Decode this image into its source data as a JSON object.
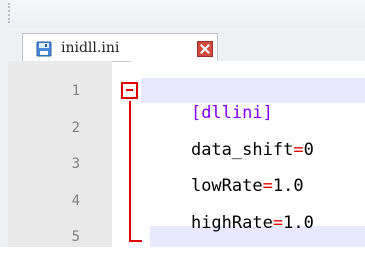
{
  "tab": {
    "label": "inidll.ini",
    "close_icon": "close-icon",
    "save_icon": "save-icon"
  },
  "editor": {
    "line_numbers": [
      "1",
      "2",
      "3",
      "4",
      "5"
    ],
    "lines": {
      "section": "[dllini]",
      "data_shift_key": "data_shift",
      "data_shift_eq": "=",
      "data_shift_value": "0",
      "lowrate_key": "lowRate",
      "lowrate_eq": "=",
      "lowrate_value": "1.0",
      "highrate_key": "highRate",
      "highrate_eq": "=",
      "highrate_value": "1.0"
    }
  },
  "colors": {
    "section": "#8000ff",
    "equals": "#e00000",
    "line_highlight": "#e8e8ff",
    "gutter_background": "#e9e9e9"
  }
}
